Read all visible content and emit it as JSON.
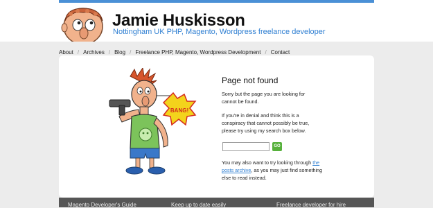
{
  "site": {
    "title": "Jamie Huskisson",
    "tagline": "Nottingham UK PHP, Magento, Wordpress freelance developer"
  },
  "nav": {
    "items": [
      {
        "label": "About"
      },
      {
        "label": "Archives"
      },
      {
        "label": "Blog"
      },
      {
        "label": "Freelance PHP, Magento, Wordpress Development"
      },
      {
        "label": "Contact"
      }
    ],
    "separator": "/"
  },
  "main": {
    "heading": "Page not found",
    "para1": "Sorry but the page you are looking for cannot be found.",
    "para2": "If you're in denial and think this is a conspiracy that cannot possibly be true, please try using my search box below.",
    "para3_before": "You may also want to try looking through ",
    "para3_link": "the posts archive",
    "para3_after": ", as you may just find something else to read instead.",
    "search": {
      "value": "",
      "placeholder": ""
    },
    "go_label": "GO",
    "bang_text": "BANG!"
  },
  "footer": {
    "headings": [
      "Magento Developer's Guide",
      "Keep up to date easily",
      "Freelance developer for hire"
    ]
  },
  "colors": {
    "accent_blue": "#2f7fd2",
    "go_green": "#57b13c",
    "footer_bg": "#565656"
  }
}
